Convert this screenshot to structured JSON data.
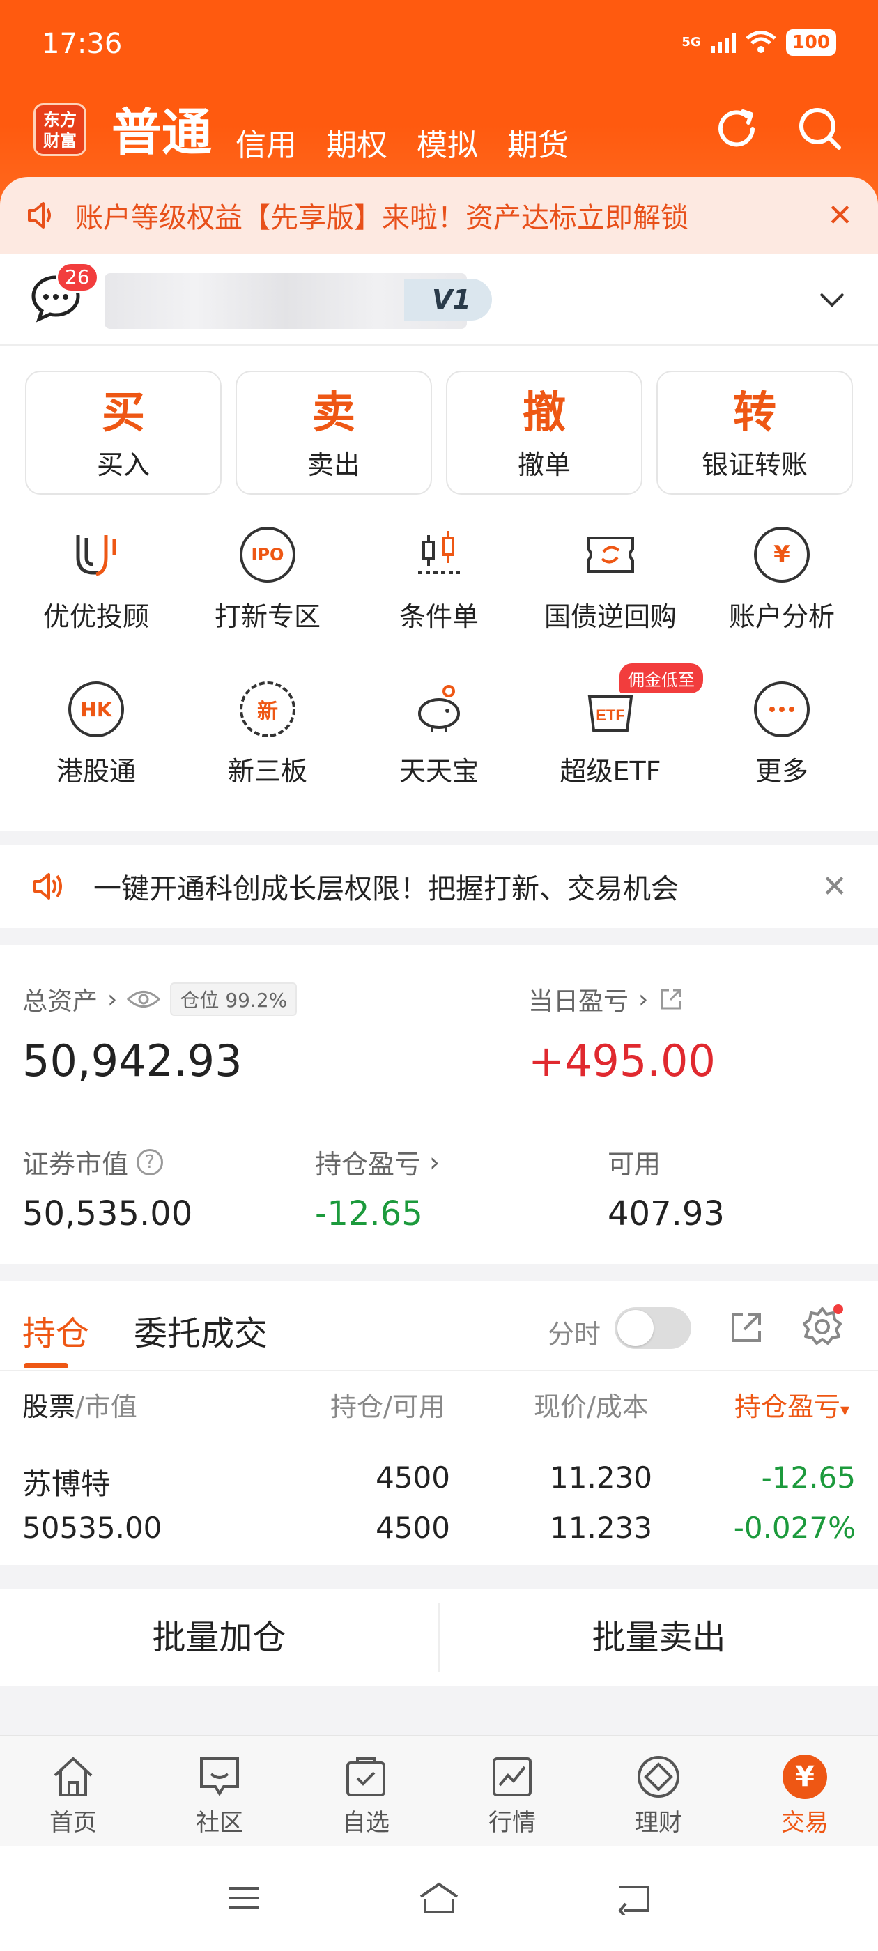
{
  "status": {
    "time": "17:36",
    "network": "5G",
    "battery": "100"
  },
  "header": {
    "logo": [
      "东方",
      "财富"
    ],
    "tabs": [
      "普通",
      "信用",
      "期权",
      "模拟",
      "期货"
    ]
  },
  "notice_top": {
    "text": "账户等级权益【先享版】来啦！资产达标立即解锁"
  },
  "account": {
    "msg_count": "26",
    "level": "V1"
  },
  "trade_buttons": [
    {
      "big": "买",
      "label": "买入"
    },
    {
      "big": "卖",
      "label": "卖出"
    },
    {
      "big": "撤",
      "label": "撤单"
    },
    {
      "big": "转",
      "label": "银证转账"
    }
  ],
  "features_row1": [
    "优优投顾",
    "打新专区",
    "条件单",
    "国债逆回购",
    "账户分析"
  ],
  "features_row2": [
    "港股通",
    "新三板",
    "天天宝",
    "超级ETF",
    "更多"
  ],
  "feature_tag": "佣金低至",
  "icon_text": {
    "ipo": "IPO",
    "hk": "HK",
    "new": "新",
    "etf": "ETF",
    "yen": "¥"
  },
  "notice_mid": {
    "text": "一键开通科创成长层权限！把握打新、交易机会"
  },
  "assets": {
    "total_label": "总资产",
    "position_label": "仓位 99.2%",
    "total_value": "50,942.93",
    "daily_label": "当日盈亏",
    "daily_value": "+495.00",
    "market_label": "证券市值",
    "market_value": "50,535.00",
    "hold_pl_label": "持仓盈亏",
    "hold_pl_value": "-12.65",
    "available_label": "可用",
    "available_value": "407.93"
  },
  "holdings": {
    "tabs": [
      "持仓",
      "委托成交"
    ],
    "intraday_label": "分时",
    "headers": {
      "c1a": "股票",
      "c1b": "/市值",
      "c2": "持仓/可用",
      "c3": "现价/成本",
      "c4": "持仓盈亏"
    },
    "row": {
      "name": "苏博特",
      "market_value": "50535.00",
      "hold": "4500",
      "available": "4500",
      "price": "11.230",
      "cost": "11.233",
      "pl": "-12.65",
      "pl_pct": "-0.027%"
    }
  },
  "batch": {
    "add": "批量加仓",
    "sell": "批量卖出"
  },
  "bottom_nav": [
    "首页",
    "社区",
    "自选",
    "行情",
    "理财",
    "交易"
  ],
  "trade_icon": "¥",
  "colors": {
    "brand": "#ff5a0f",
    "accent": "#ee5714",
    "red": "#e0292f",
    "green": "#1c9a3c"
  }
}
